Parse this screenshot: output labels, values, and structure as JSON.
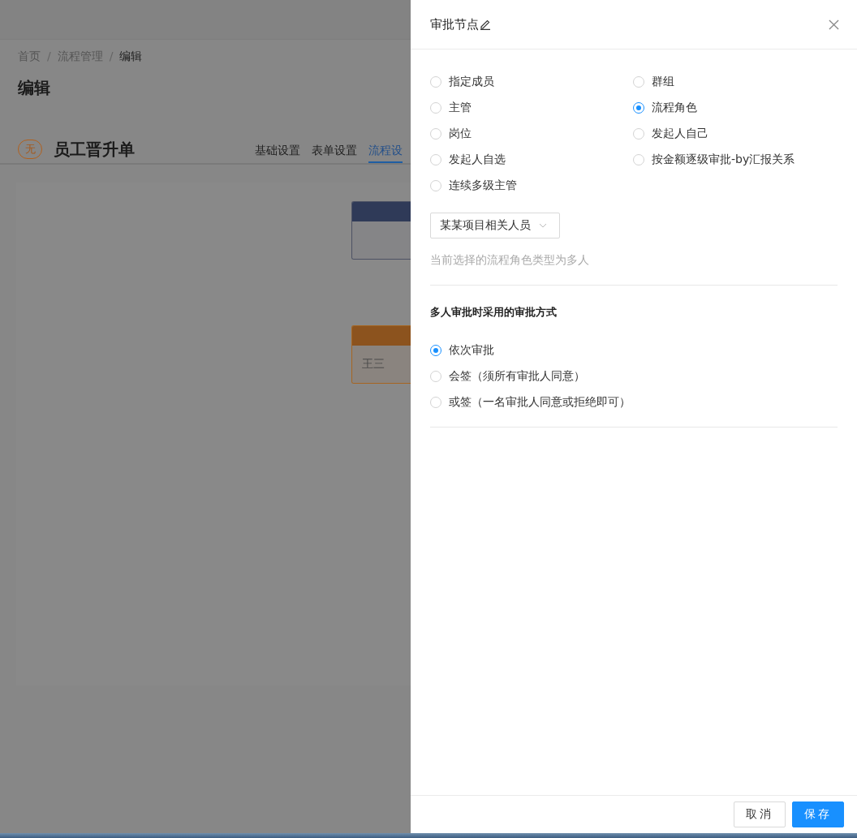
{
  "breadcrumb": {
    "separator": "/",
    "items": [
      {
        "label": "首页",
        "current": false
      },
      {
        "label": "流程管理",
        "current": false
      },
      {
        "label": "编辑",
        "current": true
      }
    ]
  },
  "page_title": "编辑",
  "form": {
    "badge": "无",
    "name": "员工晋升单"
  },
  "tabs": [
    {
      "label": "基础设置",
      "selected": false
    },
    {
      "label": "表单设置",
      "selected": false
    },
    {
      "label": "流程设",
      "selected": true
    }
  ],
  "flow_nodes": [
    {
      "kind": "start"
    },
    {
      "kind": "approver",
      "body": "王三"
    }
  ],
  "drawer": {
    "title": "审批节点",
    "approver_types": [
      {
        "label": "指定成员",
        "selected": false
      },
      {
        "label": "群组",
        "selected": false
      },
      {
        "label": "主管",
        "selected": false
      },
      {
        "label": "流程角色",
        "selected": true
      },
      {
        "label": "岗位",
        "selected": false
      },
      {
        "label": "发起人自己",
        "selected": false
      },
      {
        "label": "发起人自选",
        "selected": false
      },
      {
        "label": "按金额逐级审批-by汇报关系",
        "selected": false
      },
      {
        "label": "连续多级主管",
        "selected": false
      }
    ],
    "role_select": {
      "value": "某某项目相关人员"
    },
    "hint": "当前选择的流程角色类型为多人",
    "multi_title": "多人审批时采用的审批方式",
    "multi_modes": [
      {
        "label": "依次审批",
        "selected": true
      },
      {
        "label": "会签（须所有审批人同意）",
        "selected": false
      },
      {
        "label": "或签（一名审批人同意或拒绝即可）",
        "selected": false
      }
    ],
    "buttons": [
      {
        "label": "取消",
        "kind": "default"
      },
      {
        "label": "保存",
        "kind": "primary"
      }
    ]
  }
}
